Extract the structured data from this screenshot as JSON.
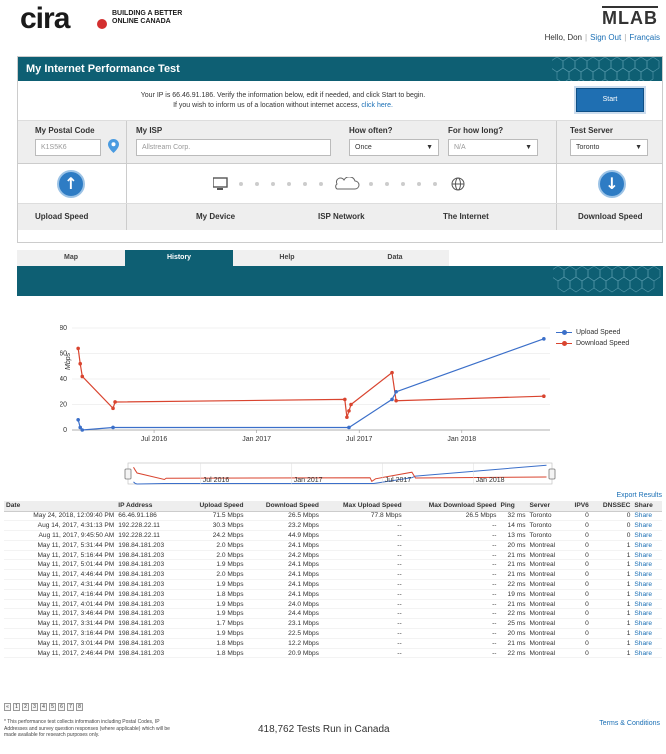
{
  "header": {
    "logo_text": "cira",
    "tagline_line1": "BUILDING A BETTER",
    "tagline_line2": "ONLINE CANADA",
    "mlab": "MLAB",
    "greeting": "Hello, Don",
    "sign_out": "Sign Out",
    "lang": "Français"
  },
  "panel": {
    "title": "My Internet Performance Test",
    "ip_line1": "Your IP is 66.46.91.186. Verify the information below, edit if needed, and click Start to begin.",
    "ip_line2_pre": "If you wish to inform us of a location without internet access,",
    "ip_link": "click here.",
    "start": "Start",
    "postal_label": "My Postal Code",
    "postal_value": "K1S5K6",
    "isp_label": "My ISP",
    "isp_value": "Allstream Corp.",
    "often_label": "How often?",
    "often_value": "Once",
    "long_label": "For how long?",
    "long_value": "N/A",
    "server_label": "Test Server",
    "server_value": "Toronto",
    "upload_label": "Upload Speed",
    "device_label": "My Device",
    "isp_network_label": "ISP Network",
    "internet_label": "The Internet",
    "download_label": "Download Speed"
  },
  "tabs": [
    "Map",
    "History",
    "Help",
    "Data"
  ],
  "chart_data": {
    "type": "line",
    "ylabel": "Mbps",
    "ylim": [
      0,
      80
    ],
    "yticks": [
      0,
      20,
      40,
      60,
      80
    ],
    "xticks": [
      "Jul 2016",
      "Jan 2017",
      "Jul 2017",
      "Jan 2018"
    ],
    "nav_ticks": [
      "Jul 2016",
      "Jan 2017",
      "Jul 2017",
      "Jan 2018"
    ],
    "series": [
      {
        "name": "Upload Speed",
        "color": "#3b6fc9",
        "points": [
          [
            2016.13,
            8
          ],
          [
            2016.14,
            2
          ],
          [
            2016.15,
            0
          ],
          [
            2016.3,
            2
          ],
          [
            2017.45,
            2
          ],
          [
            2017.66,
            24
          ],
          [
            2017.68,
            30
          ],
          [
            2018.4,
            71.5
          ]
        ]
      },
      {
        "name": "Download Speed",
        "color": "#d9442f",
        "points": [
          [
            2016.13,
            64
          ],
          [
            2016.14,
            52
          ],
          [
            2016.15,
            42
          ],
          [
            2016.3,
            17
          ],
          [
            2016.31,
            22
          ],
          [
            2017.43,
            24
          ],
          [
            2017.44,
            10
          ],
          [
            2017.45,
            15
          ],
          [
            2017.46,
            20
          ],
          [
            2017.66,
            45
          ],
          [
            2017.68,
            23
          ],
          [
            2018.4,
            26.5
          ]
        ]
      }
    ]
  },
  "table": {
    "export": "Export Results",
    "headers": [
      "Date",
      "IP Address",
      "Upload Speed",
      "Download Speed",
      "Max Upload Speed",
      "Max Download Speed",
      "Ping",
      "Server",
      "IPV6",
      "DNSSEC",
      "Share"
    ],
    "rows": [
      [
        "May 24, 2018, 12:09:40 PM",
        "66.46.91.186",
        "71.5 Mbps",
        "26.5 Mbps",
        "77.8 Mbps",
        "26.5 Mbps",
        "32 ms",
        "Toronto",
        "0",
        "0",
        "Share"
      ],
      [
        "Aug 14, 2017, 4:31:13 PM",
        "192.228.22.11",
        "30.3 Mbps",
        "23.2 Mbps",
        "--",
        "--",
        "14 ms",
        "Toronto",
        "0",
        "0",
        "Share"
      ],
      [
        "Aug 11, 2017, 9:45:50 AM",
        "192.228.22.11",
        "24.2 Mbps",
        "44.9 Mbps",
        "--",
        "--",
        "13 ms",
        "Toronto",
        "0",
        "0",
        "Share"
      ],
      [
        "May 11, 2017, 5:31:44 PM",
        "198.84.181.203",
        "2.0 Mbps",
        "24.1 Mbps",
        "--",
        "--",
        "20 ms",
        "Montreal",
        "0",
        "1",
        "Share"
      ],
      [
        "May 11, 2017, 5:16:44 PM",
        "198.84.181.203",
        "2.0 Mbps",
        "24.2 Mbps",
        "--",
        "--",
        "21 ms",
        "Montreal",
        "0",
        "1",
        "Share"
      ],
      [
        "May 11, 2017, 5:01:44 PM",
        "198.84.181.203",
        "1.9 Mbps",
        "24.1 Mbps",
        "--",
        "--",
        "21 ms",
        "Montreal",
        "0",
        "1",
        "Share"
      ],
      [
        "May 11, 2017, 4:46:44 PM",
        "198.84.181.203",
        "2.0 Mbps",
        "24.1 Mbps",
        "--",
        "--",
        "21 ms",
        "Montreal",
        "0",
        "1",
        "Share"
      ],
      [
        "May 11, 2017, 4:31:44 PM",
        "198.84.181.203",
        "1.9 Mbps",
        "24.1 Mbps",
        "--",
        "--",
        "22 ms",
        "Montreal",
        "0",
        "1",
        "Share"
      ],
      [
        "May 11, 2017, 4:16:44 PM",
        "198.84.181.203",
        "1.8 Mbps",
        "24.1 Mbps",
        "--",
        "--",
        "19 ms",
        "Montreal",
        "0",
        "1",
        "Share"
      ],
      [
        "May 11, 2017, 4:01:44 PM",
        "198.84.181.203",
        "1.9 Mbps",
        "24.0 Mbps",
        "--",
        "--",
        "21 ms",
        "Montreal",
        "0",
        "1",
        "Share"
      ],
      [
        "May 11, 2017, 3:46:44 PM",
        "198.84.181.203",
        "1.9 Mbps",
        "24.4 Mbps",
        "--",
        "--",
        "22 ms",
        "Montreal",
        "0",
        "1",
        "Share"
      ],
      [
        "May 11, 2017, 3:31:44 PM",
        "198.84.181.203",
        "1.7 Mbps",
        "23.1 Mbps",
        "--",
        "--",
        "25 ms",
        "Montreal",
        "0",
        "1",
        "Share"
      ],
      [
        "May 11, 2017, 3:16:44 PM",
        "198.84.181.203",
        "1.9 Mbps",
        "22.5 Mbps",
        "--",
        "--",
        "20 ms",
        "Montreal",
        "0",
        "1",
        "Share"
      ],
      [
        "May 11, 2017, 3:01:44 PM",
        "198.84.181.203",
        "1.8 Mbps",
        "12.2 Mbps",
        "--",
        "--",
        "21 ms",
        "Montreal",
        "0",
        "1",
        "Share"
      ],
      [
        "May 11, 2017, 2:46:44 PM",
        "198.84.181.203",
        "1.8 Mbps",
        "20.9 Mbps",
        "--",
        "--",
        "22 ms",
        "Montreal",
        "0",
        "1",
        "Share"
      ]
    ],
    "pages": [
      "1",
      "2",
      "3",
      "4",
      "5",
      "6",
      "7",
      "8"
    ]
  },
  "footer": {
    "note": "* This performance test collects information including Postal Codes, IP Addresses and survey question responses (where applicable) which will be made available for research purposes only.",
    "tests_run": "418,762 Tests Run in Canada",
    "terms": "Terms & Conditions"
  }
}
